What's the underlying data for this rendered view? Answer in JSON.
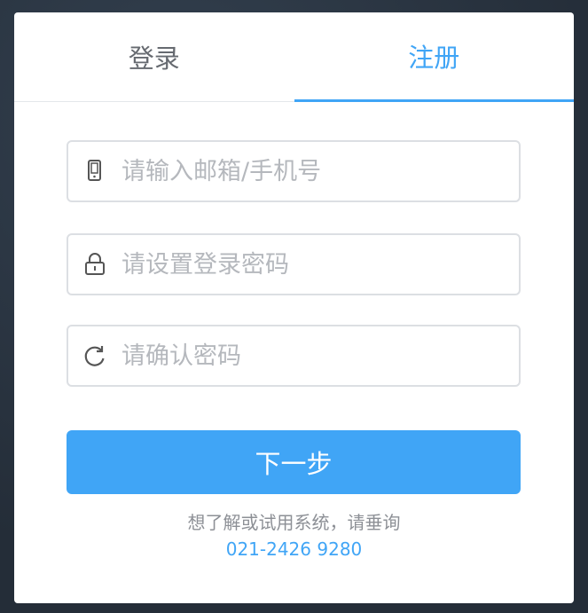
{
  "tabs": {
    "login_label": "登录",
    "register_label": "注册",
    "active": "register"
  },
  "form": {
    "account_placeholder": "请输入邮箱/手机号",
    "password_placeholder": "请设置登录密码",
    "confirm_placeholder": "请确认密码",
    "account_icon": "phone-icon",
    "password_icon": "lock-icon",
    "confirm_icon": "refresh-icon",
    "next_label": "下一步"
  },
  "footer": {
    "hint_text": "想了解或试用系统，请垂询",
    "phone_number": "021-2426 9280"
  },
  "colors": {
    "accent": "#40a5f6",
    "background": "#2a3441",
    "border": "#dcdfe3"
  }
}
